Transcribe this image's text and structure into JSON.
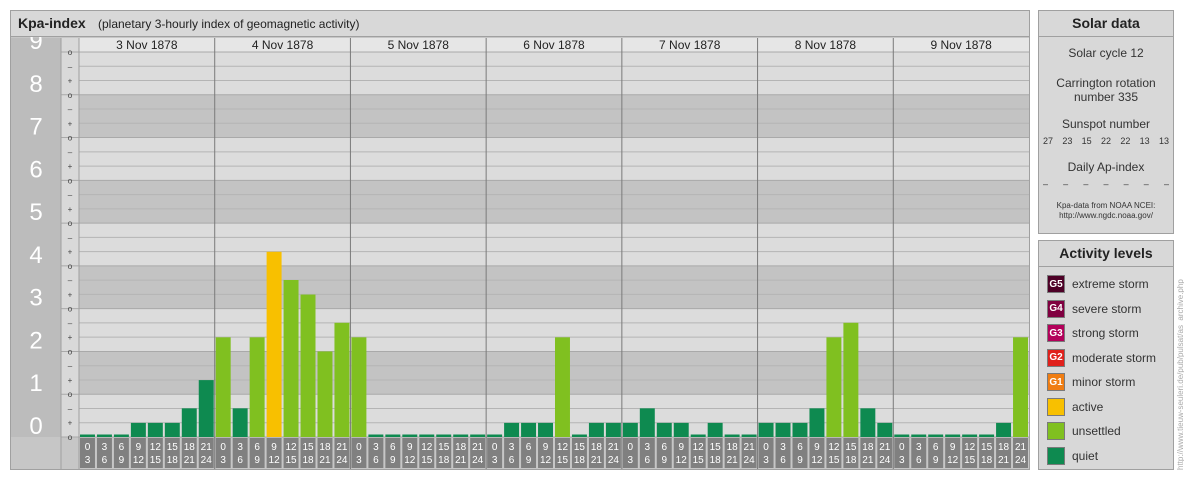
{
  "title": "Kpa-index",
  "subtitle": "(planetary 3-hourly index of geomagnetic activity)",
  "chart_data": {
    "type": "bar",
    "ylim": [
      0,
      9
    ],
    "y_major_labels": [
      "0",
      "1",
      "2",
      "3",
      "4",
      "5",
      "6",
      "7",
      "8",
      "9"
    ],
    "y_minor_labels": [
      "+",
      "o",
      "–"
    ],
    "days": [
      "3 Nov 1878",
      "4 Nov 1878",
      "5 Nov 1878",
      "6 Nov 1878",
      "7 Nov 1878",
      "8 Nov 1878",
      "9 Nov 1878"
    ],
    "interval_start": [
      "0",
      "3",
      "6",
      "9",
      "12",
      "15",
      "18",
      "21"
    ],
    "interval_end": [
      "3",
      "6",
      "9",
      "12",
      "15",
      "18",
      "21",
      "24"
    ],
    "values": [
      [
        0.0,
        0.0,
        0.0,
        0.33,
        0.33,
        0.33,
        0.67,
        1.33
      ],
      [
        2.33,
        0.67,
        2.33,
        4.33,
        3.67,
        3.33,
        2.0,
        2.67
      ],
      [
        2.33,
        0.0,
        0.0,
        0.0,
        0.0,
        0.0,
        0.0,
        0.0
      ],
      [
        0.0,
        0.33,
        0.33,
        0.33,
        2.33,
        0.0,
        0.33,
        0.33
      ],
      [
        0.33,
        0.67,
        0.33,
        0.33,
        0.0,
        0.33,
        0.0,
        0.0
      ],
      [
        0.33,
        0.33,
        0.33,
        0.67,
        2.33,
        2.67,
        0.67,
        0.33
      ],
      [
        0.0,
        0.0,
        0.0,
        0.0,
        0.0,
        0.0,
        0.33,
        2.33
      ]
    ]
  },
  "solar": {
    "heading": "Solar data",
    "cycle": "Solar cycle 12",
    "carrington_line1": "Carrington rotation",
    "carrington_line2": "number 335",
    "sunspot_label": "Sunspot number",
    "sunspots": [
      "27",
      "23",
      "15",
      "22",
      "22",
      "13",
      "13"
    ],
    "ap_label": "Daily Ap-index",
    "ap_values": [
      "–",
      "–",
      "–",
      "–",
      "–",
      "–",
      "–"
    ],
    "source_line1": "Kpa-data from NOAA NCEI:",
    "source_line2": "http://www.ngdc.noaa.gov/"
  },
  "activity": {
    "heading": "Activity levels",
    "levels": [
      {
        "code": "G5",
        "label": "extreme storm",
        "color": "#4d0026"
      },
      {
        "code": "G4",
        "label": "severe storm",
        "color": "#800040"
      },
      {
        "code": "G3",
        "label": "strong storm",
        "color": "#b3005a"
      },
      {
        "code": "G2",
        "label": "moderate storm",
        "color": "#e0201b"
      },
      {
        "code": "G1",
        "label": "minor storm",
        "color": "#f07d12"
      },
      {
        "code": "",
        "label": "active",
        "color": "#f8c000"
      },
      {
        "code": "",
        "label": "unsettled",
        "color": "#80c020"
      },
      {
        "code": "",
        "label": "quiet",
        "color": "#0e8a50"
      }
    ]
  },
  "credit": "http://www.tieuw-seuleri.de/pub/pulsat/as_archive.php"
}
